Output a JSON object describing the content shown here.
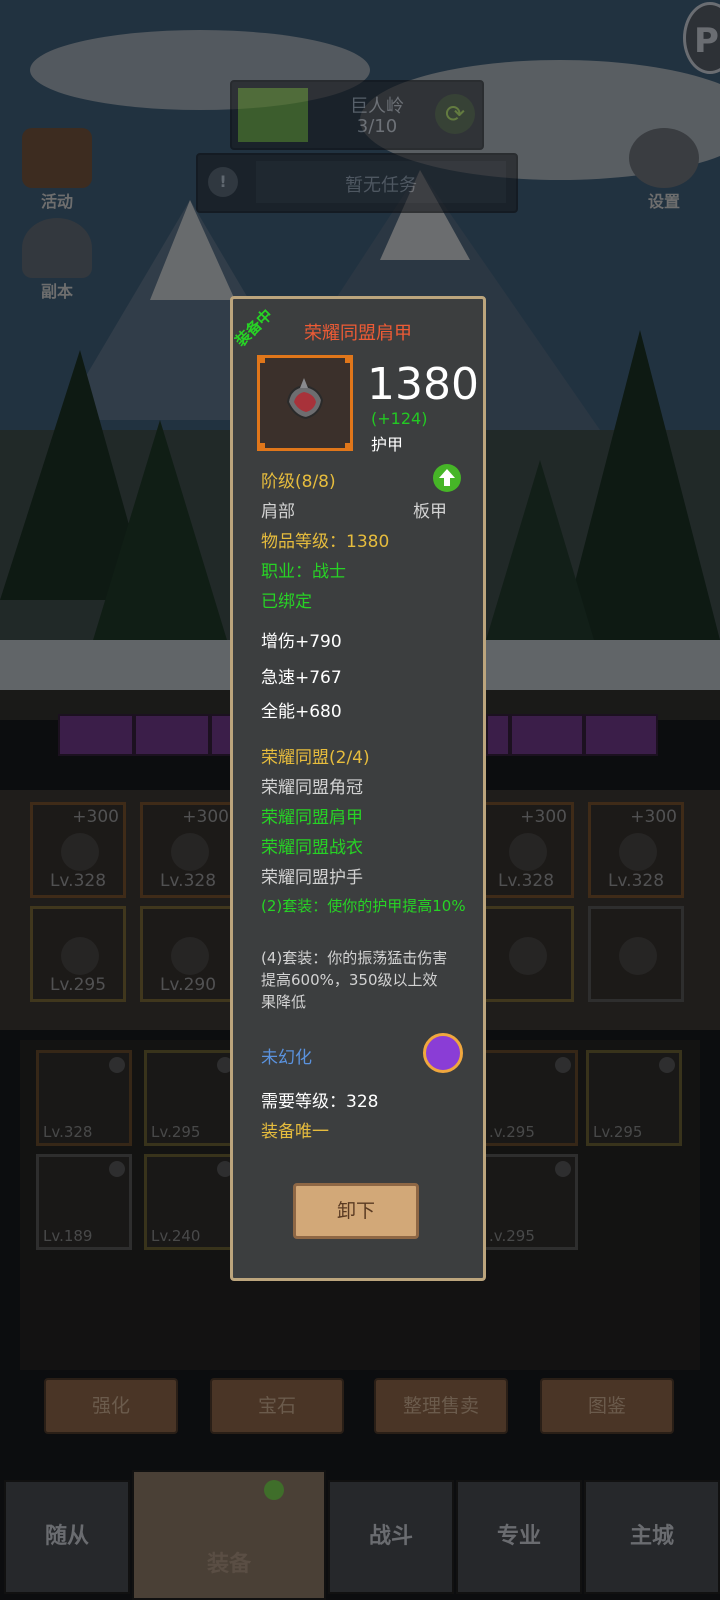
{
  "hud": {
    "zone_name": "巨人岭",
    "zone_progress": "3/10",
    "task_text": "暂无任务",
    "activity_label": "活动",
    "dungeon_label": "副本",
    "settings_label": "设置",
    "corner_icon": "P"
  },
  "equipment_slots": [
    {
      "plus": "+300",
      "level": "Lv.328"
    },
    {
      "plus": "+300",
      "level": "Lv.328"
    },
    {
      "plus": "+300",
      "level": "Lv.328"
    },
    {
      "plus": "+300",
      "level": "Lv.328"
    },
    {
      "level": "Lv.295"
    },
    {
      "level": "Lv.290"
    }
  ],
  "inventory": [
    {
      "level": "Lv.328"
    },
    {
      "level": "Lv.295"
    },
    {
      "level": ".v.295"
    },
    {
      "level": "Lv.295"
    },
    {
      "level": "Lv.189"
    },
    {
      "level": "Lv.240"
    },
    {
      "level": ".v.295"
    }
  ],
  "actions": [
    "强化",
    "宝石",
    "整理售卖",
    "图鉴"
  ],
  "tabs": [
    "随从",
    "装备",
    "战斗",
    "专业",
    "主城"
  ],
  "popup": {
    "equipped_tag": "装备中",
    "item_name": "荣耀同盟肩甲",
    "armor_value": "1380",
    "armor_delta": "(+124)",
    "armor_label": "护甲",
    "tier": "阶级(8/8)",
    "slot": "肩部",
    "armor_type": "板甲",
    "item_level": "物品等级：1380",
    "class_req": "职业：战士",
    "bound": "已绑定",
    "stats": [
      "增伤+790",
      "急速+767",
      "全能+680"
    ],
    "set_name": "荣耀同盟(2/4)",
    "set_items": [
      {
        "name": "荣耀同盟角冠",
        "owned": false
      },
      {
        "name": "荣耀同盟肩甲",
        "owned": true
      },
      {
        "name": "荣耀同盟战衣",
        "owned": true
      },
      {
        "name": "荣耀同盟护手",
        "owned": false
      }
    ],
    "bonus_2": "(2)套装：使你的护甲提高10%",
    "bonus_4": "(4)套装：你的振荡猛击伤害提高600%，350级以上效果降低",
    "transmog": "未幻化",
    "level_req": "需要等级：328",
    "unique": "装备唯一",
    "unequip_button": "卸下"
  },
  "colors": {
    "item_name": "#ee5b35",
    "yellow": "#e6bc3d",
    "green": "#27d325",
    "blue": "#5a92de",
    "popup_border": "#bca57d"
  }
}
